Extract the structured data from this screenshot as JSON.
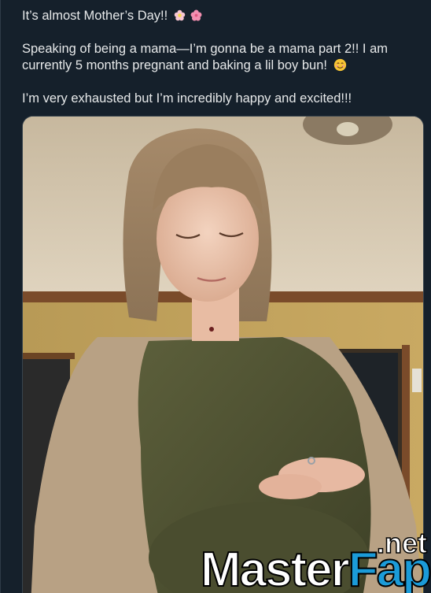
{
  "post": {
    "line1": "It’s almost Mother’s Day!! ",
    "line2": "Speaking of being a mama—I’m gonna be a mama part 2!! I am currently 5 months pregnant and baking a lil boy bun! ",
    "line3": "I’m very exhausted but I’m incredibly happy and excited!!!"
  },
  "icons": {
    "line1": [
      "flower-icon",
      "cherry-blossom-icon"
    ],
    "line2": "smiling-face-icon"
  },
  "watermark": {
    "net": ".net",
    "part1": "Master",
    "part2": "Fap",
    "color_accent": "#1b9bd8"
  },
  "colors": {
    "background": "#15202b",
    "text": "#e7e9ea"
  }
}
